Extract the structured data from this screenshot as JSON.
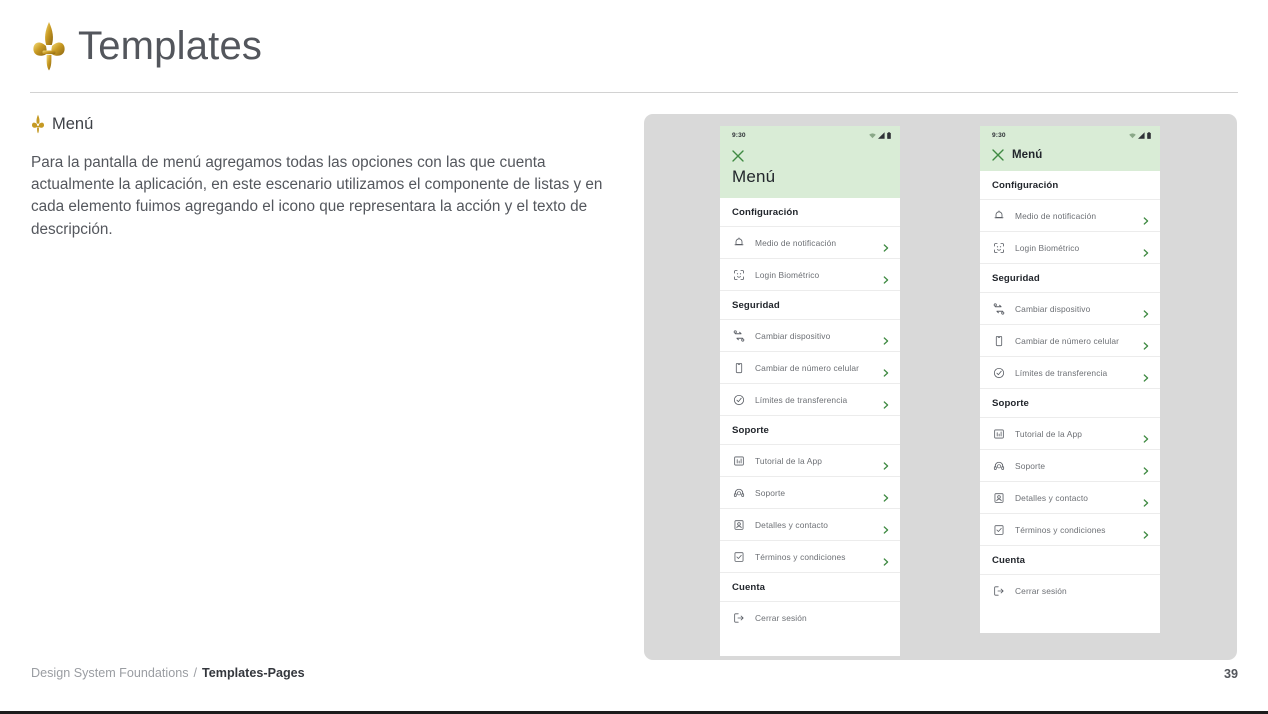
{
  "header": {
    "title": "Templates",
    "logo_icon": "fleur-de-lis-icon"
  },
  "content": {
    "section_icon": "fleur-de-lis-icon",
    "section_title": "Menú",
    "paragraph": "Para la pantalla de menú agregamos todas las opciones con las que cuenta actualmente la aplicación, en este escenario utilizamos el componente de listas y en cada elemento fuimos agregando el icono que representara la acción y el texto de descripción."
  },
  "mockups": {
    "canvas_color": "#d9d9d9",
    "header_green": "#d9ecd6",
    "accent_green": "#3f8a42",
    "phone_a": {
      "status": {
        "time": "9:30",
        "icons": [
          "wifi-icon",
          "signal-icon",
          "battery-icon"
        ]
      },
      "close_icon": "close-icon",
      "title": "Menú",
      "groups": [
        {
          "label": "Configuración",
          "items": [
            {
              "icon": "bell-icon",
              "label": "Medio de notificación",
              "chevron": "chevron-right-icon"
            },
            {
              "icon": "face-id-icon",
              "label": "Login Biométrico",
              "chevron": "chevron-right-icon"
            }
          ]
        },
        {
          "label": "Seguridad",
          "items": [
            {
              "icon": "swap-device-icon",
              "label": "Cambiar dispositivo",
              "chevron": "chevron-right-icon"
            },
            {
              "icon": "mobile-icon",
              "label": "Cambiar de número celular",
              "chevron": "chevron-right-icon"
            },
            {
              "icon": "check-circle-icon",
              "label": "Límites de transferencia",
              "chevron": "chevron-right-icon"
            }
          ]
        },
        {
          "label": "Soporte",
          "items": [
            {
              "icon": "presentation-icon",
              "label": "Tutorial de la App",
              "chevron": "chevron-right-icon"
            },
            {
              "icon": "headset-icon",
              "label": "Soporte",
              "chevron": "chevron-right-icon"
            },
            {
              "icon": "contact-card-icon",
              "label": "Detalles y contacto",
              "chevron": "chevron-right-icon"
            },
            {
              "icon": "checkbox-doc-icon",
              "label": "Términos y condiciones",
              "chevron": "chevron-right-icon"
            }
          ]
        },
        {
          "label": "Cuenta",
          "items": [
            {
              "icon": "logout-icon",
              "label": "Cerrar sesión",
              "chevron": ""
            }
          ]
        }
      ]
    },
    "phone_b": {
      "status": {
        "time": "9:30",
        "icons": [
          "wifi-icon",
          "signal-icon",
          "battery-icon"
        ]
      },
      "close_icon": "close-icon",
      "title": "Menú",
      "groups": [
        {
          "label": "Configuración",
          "items": [
            {
              "icon": "bell-icon",
              "label": "Medio de notificación",
              "chevron": "chevron-right-icon"
            },
            {
              "icon": "face-id-icon",
              "label": "Login Biométrico",
              "chevron": "chevron-right-icon"
            }
          ]
        },
        {
          "label": "Seguridad",
          "items": [
            {
              "icon": "swap-device-icon",
              "label": "Cambiar dispositivo",
              "chevron": "chevron-right-icon"
            },
            {
              "icon": "mobile-icon",
              "label": "Cambiar de número celular",
              "chevron": "chevron-right-icon"
            },
            {
              "icon": "check-circle-icon",
              "label": "Límites de transferencia",
              "chevron": "chevron-right-icon"
            }
          ]
        },
        {
          "label": "Soporte",
          "items": [
            {
              "icon": "presentation-icon",
              "label": "Tutorial de la App",
              "chevron": "chevron-right-icon"
            },
            {
              "icon": "headset-icon",
              "label": "Soporte",
              "chevron": "chevron-right-icon"
            },
            {
              "icon": "contact-card-icon",
              "label": "Detalles y contacto",
              "chevron": "chevron-right-icon"
            },
            {
              "icon": "checkbox-doc-icon",
              "label": "Términos y condiciones",
              "chevron": "chevron-right-icon"
            }
          ]
        },
        {
          "label": "Cuenta",
          "items": [
            {
              "icon": "logout-icon",
              "label": "Cerrar sesión",
              "chevron": ""
            }
          ]
        }
      ]
    }
  },
  "footer": {
    "breadcrumb_parent": "Design System Foundations",
    "breadcrumb_sep": "/",
    "breadcrumb_current": "Templates-Pages",
    "page_number": "39"
  }
}
